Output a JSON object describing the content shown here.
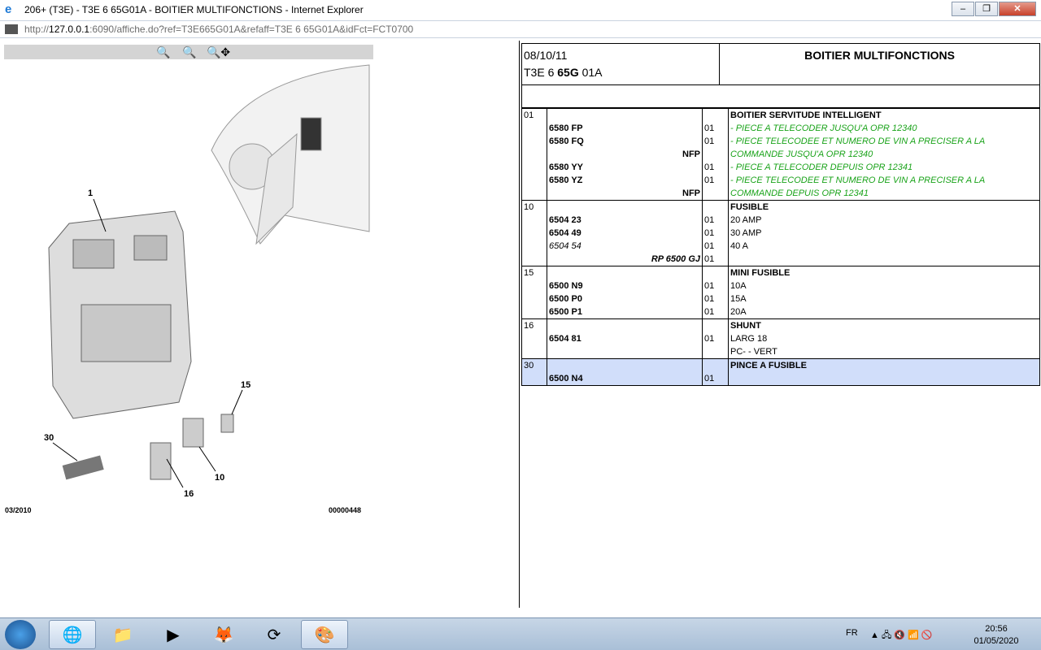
{
  "window": {
    "title": "206+ (T3E) - T3E 6 65G01A - BOITIER MULTIFONCTIONS - Internet Explorer",
    "url_prefix": "http://",
    "url_host": "127.0.0.1",
    "url_rest": ":6090/affiche.do?ref=T3E665G01A&refaff=T3E 6 65G01A&idFct=FCT0700"
  },
  "diagram": {
    "date": "03/2010",
    "number": "00000448",
    "callouts": [
      "1",
      "15",
      "30",
      "10",
      "16"
    ]
  },
  "header": {
    "date": "08/10/11",
    "ref_prefix": "T3E 6 ",
    "ref_bold": "65G",
    "ref_suffix": " 01A",
    "title": "BOITIER MULTIFONCTIONS"
  },
  "groups": [
    {
      "ref": "01",
      "title": "BOITIER SERVITUDE INTELLIGENT",
      "rows": [
        {
          "part": "6580 FP",
          "qty": "01",
          "desc": "- PIECE A TELECODER JUSQU'A OPR 12340"
        },
        {
          "part": "6580 FQ",
          "qty": "01",
          "desc": "- PIECE TELECODEE ET NUMERO DE VIN A PRECISER A LA"
        },
        {
          "part": "NFP",
          "qty": "",
          "desc": "COMMANDE JUSQU'A OPR 12340"
        },
        {
          "part": "6580 YY",
          "qty": "01",
          "desc": "- PIECE A TELECODER DEPUIS OPR 12341"
        },
        {
          "part": "6580 YZ",
          "qty": "01",
          "desc": "- PIECE TELECODEE ET NUMERO DE VIN A PRECISER A LA"
        },
        {
          "part": "NFP",
          "qty": "",
          "desc": "COMMANDE DEPUIS OPR 12341"
        }
      ]
    },
    {
      "ref": "10",
      "title": "FUSIBLE",
      "rows": [
        {
          "part": "6504 23",
          "qty": "01",
          "desc": "20 AMP"
        },
        {
          "part": "6504 49",
          "qty": "01",
          "desc": "30 AMP"
        },
        {
          "part": "6504 54",
          "qty": "01",
          "desc": "40 A"
        },
        {
          "part": "RP 6500 GJ",
          "qty": "01",
          "desc": ""
        }
      ]
    },
    {
      "ref": "15",
      "title": "MINI FUSIBLE",
      "rows": [
        {
          "part": "6500 N9",
          "qty": "01",
          "desc": "10A"
        },
        {
          "part": "6500 P0",
          "qty": "01",
          "desc": "15A"
        },
        {
          "part": "6500 P1",
          "qty": "01",
          "desc": "20A"
        }
      ]
    },
    {
      "ref": "16",
      "title": "SHUNT",
      "rows": [
        {
          "part": "6504 81",
          "qty": "01",
          "desc": "LARG 18"
        },
        {
          "part": "",
          "qty": "",
          "desc": "PC- - VERT"
        }
      ]
    },
    {
      "ref": "30",
      "title": "PINCE A FUSIBLE",
      "selected": true,
      "rows": [
        {
          "part": "6500 N4",
          "qty": "01",
          "desc": ""
        }
      ]
    }
  ],
  "taskbar": {
    "lang": "FR",
    "time": "20:56",
    "date": "01/05/2020"
  },
  "colors": {
    "green_text": "#1aa31a",
    "selected_row": "#d1defa"
  }
}
